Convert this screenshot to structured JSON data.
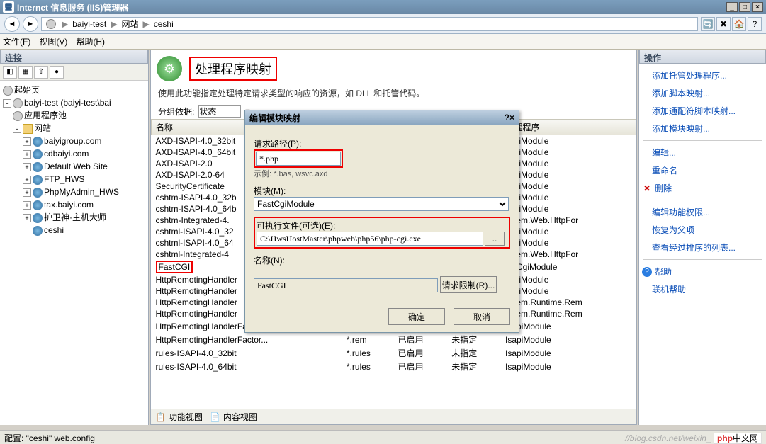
{
  "window": {
    "title": "Internet 信息服务 (IIS)管理器"
  },
  "breadcrumb": {
    "parts": [
      "baiyi-test",
      "网站",
      "ceshi"
    ]
  },
  "menu": {
    "file": "文件(F)",
    "view": "视图(V)",
    "help": "帮助(H)"
  },
  "panels": {
    "connections": "连接",
    "actions": "操作"
  },
  "tree": {
    "start": "起始页",
    "server": "baiyi-test (baiyi-test\\bai",
    "apppool": "应用程序池",
    "sites": "网站",
    "nodes": [
      "baiyigroup.com",
      "cdbaiyi.com",
      "Default Web Site",
      "FTP_HWS",
      "PhpMyAdmin_HWS",
      "tax.baiyi.com",
      "护卫神·主机大师",
      "ceshi"
    ]
  },
  "page": {
    "title": "处理程序映射",
    "desc": "使用此功能指定处理特定请求类型的响应的资源，如 DLL 和托管代码。",
    "group_label": "分组依据:",
    "group_value": "状态"
  },
  "grid": {
    "cols": [
      "名称",
      "",
      "",
      "",
      "处理程序"
    ],
    "rows": [
      [
        "AXD-ISAPI-4.0_32bit",
        "",
        "",
        "",
        "sapiModule"
      ],
      [
        "AXD-ISAPI-4.0_64bit",
        "",
        "",
        "",
        "sapiModule"
      ],
      [
        "AXD-ISAPI-2.0",
        "",
        "",
        "",
        "sapiModule"
      ],
      [
        "AXD-ISAPI-2.0-64",
        "",
        "",
        "",
        "sapiModule"
      ],
      [
        "SecurityCertificate",
        "",
        "",
        "",
        "sapiModule"
      ],
      [
        "cshtm-ISAPI-4.0_32b",
        "",
        "",
        "",
        "sapiModule"
      ],
      [
        "cshtm-ISAPI-4.0_64b",
        "",
        "",
        "",
        "sapiModule"
      ],
      [
        "cshtm-Integrated-4.",
        "",
        "",
        "",
        "ystem.Web.HttpFor"
      ],
      [
        "cshtml-ISAPI-4.0_32",
        "",
        "",
        "",
        "sapiModule"
      ],
      [
        "cshtml-ISAPI-4.0_64",
        "",
        "",
        "",
        "sapiModule"
      ],
      [
        "cshtml-Integrated-4",
        "",
        "",
        "",
        "ystem.Web.HttpFor"
      ],
      [
        "FastCGI",
        "",
        "",
        "",
        "astCgiModule"
      ],
      [
        "HttpRemotingHandler",
        "",
        "",
        "",
        "sapiModule"
      ],
      [
        "HttpRemotingHandler",
        "",
        "",
        "",
        "sapiModule"
      ],
      [
        "HttpRemotingHandler",
        "",
        "",
        "",
        "ystem.Runtime.Rem"
      ],
      [
        "HttpRemotingHandler",
        "",
        "",
        "",
        "ystem.Runtime.Rem"
      ],
      [
        "HttpRemotingHandlerFactor...",
        "*.rem",
        "已启用",
        "未指定",
        "IsapiModule"
      ],
      [
        "HttpRemotingHandlerFactor...",
        "*.rem",
        "已启用",
        "未指定",
        "IsapiModule"
      ],
      [
        "rules-ISAPI-4.0_32bit",
        "*.rules",
        "已启用",
        "未指定",
        "IsapiModule"
      ],
      [
        "rules-ISAPI-4.0_64bit",
        "*.rules",
        "已启用",
        "未指定",
        "IsapiModule"
      ]
    ]
  },
  "tabs": {
    "feature": "功能视图",
    "content": "内容视图"
  },
  "actions": {
    "a1": "添加托管处理程序...",
    "a2": "添加脚本映射...",
    "a3": "添加通配符脚本映射...",
    "a4": "添加模块映射...",
    "edit": "编辑...",
    "rename": "重命名",
    "delete": "删除",
    "perm": "编辑功能权限...",
    "restore": "恢复为父项",
    "sorted": "查看经过排序的列表...",
    "help": "帮助",
    "online": "联机帮助"
  },
  "dialog": {
    "title": "编辑模块映射",
    "path_label": "请求路径(P):",
    "path_value": "*.php",
    "path_hint": "示例: *.bas, wsvc.axd",
    "module_label": "模块(M):",
    "module_value": "FastCgiModule",
    "exe_label": "可执行文件(可选)(E):",
    "exe_value": "C:\\HwsHostMaster\\phpweb\\php56\\php-cgi.exe",
    "exe_highlight": "php56",
    "name_label": "名称(N):",
    "name_value": "FastCGI",
    "limit": "请求限制(R)...",
    "ok": "确定",
    "cancel": "取消"
  },
  "status": {
    "config": "配置: \"ceshi\" web.config",
    "watermark": "//blog.csdn.net/weixin_",
    "brand_prefix": "php",
    "brand_suffix": "中文网"
  }
}
